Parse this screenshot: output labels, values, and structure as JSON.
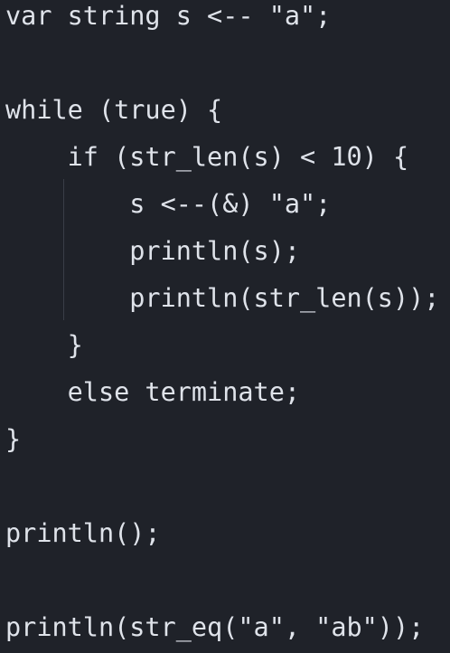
{
  "editor": {
    "lines": [
      "var string s <-- \"a\";",
      "",
      "while (true) {",
      "    if (str_len(s) < 10) {",
      "        s <--(&) \"a\";",
      "        println(s);",
      "        println(str_len(s));",
      "    }",
      "    else terminate;",
      "}",
      "",
      "println();",
      "",
      "println(str_eq(\"a\", \"ab\"));"
    ]
  }
}
